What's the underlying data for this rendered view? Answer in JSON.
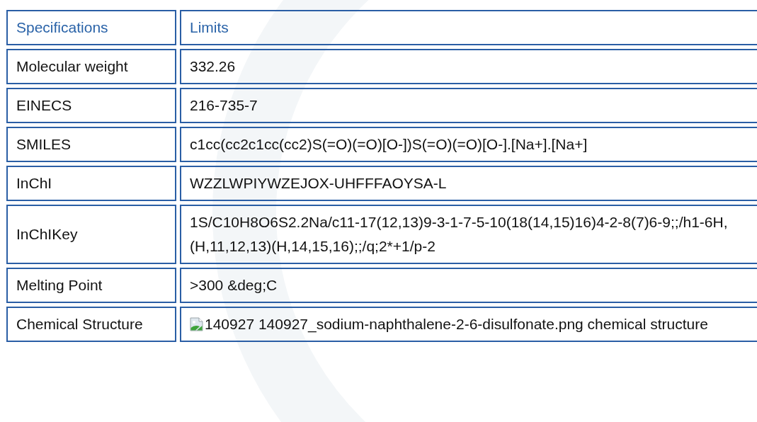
{
  "table": {
    "columns": [
      "Specifications",
      "Limits"
    ],
    "rows": [
      {
        "label": "Molecular weight",
        "value": "332.26",
        "kind": "text"
      },
      {
        "label": "EINECS",
        "value": "216-735-7",
        "kind": "text"
      },
      {
        "label": "SMILES",
        "value": "c1cc(cc2c1cc(cc2)S(=O)(=O)[O-])S(=O)(=O)[O-].[Na+].[Na+]",
        "kind": "text"
      },
      {
        "label": "InChI",
        "value": "WZZLWPIYWZEJOX-UHFFFAOYSA-L",
        "kind": "text"
      },
      {
        "label": "InChIKey",
        "value": "1S/C10H8O6S2.2Na/c11-17(12,13)9-3-1-7-5-10(18(14,15)16)4-2-8(7)6-9;;/h1-6H,(H,11,12,13)(H,14,15,16);;/q;2*+1/p-2",
        "kind": "text"
      },
      {
        "label": "Melting Point",
        "value": ">300 &deg;C",
        "kind": "text"
      },
      {
        "label": "Chemical Structure",
        "value": "140927 140927_sodium-naphthalene-2-6-disulfonate.png chemical structure",
        "kind": "broken_image"
      }
    ]
  }
}
